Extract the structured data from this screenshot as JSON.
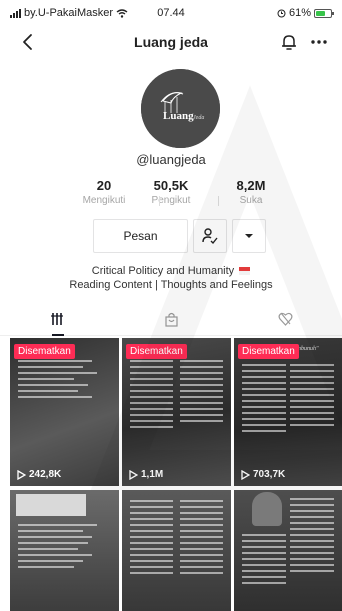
{
  "status_bar": {
    "carrier": "by.U-PakaiMasker",
    "time": "07.44",
    "battery": "61%",
    "battery_level": 0.61
  },
  "nav": {
    "title": "Luang jeda"
  },
  "profile": {
    "handle": "@luangjeda",
    "avatar_text": "Luang",
    "avatar_script": "Jeda",
    "stats": [
      {
        "value": "20",
        "label": "Mengikuti"
      },
      {
        "value": "50,5K",
        "label": "Pengikut"
      },
      {
        "value": "8,2M",
        "label": "Suka"
      }
    ],
    "message_button": "Pesan",
    "bio_line1": "Critical Politicy and Humanity",
    "bio_line2": "Reading Content | Thoughts and Feelings"
  },
  "tabs": [
    {
      "icon": "grid-icon"
    },
    {
      "icon": "shopping-bag-icon"
    },
    {
      "icon": "liked-heart-icon"
    }
  ],
  "videos": [
    {
      "pinned": "Disematkan",
      "views": "242,8K"
    },
    {
      "pinned": "Disematkan",
      "views": "1,1M"
    },
    {
      "pinned": "Disematkan",
      "views": "703,7K",
      "heading": "Ayah Bukan Pembunuh"
    },
    {
      "pinned": "",
      "views": ""
    },
    {
      "pinned": "",
      "views": ""
    },
    {
      "pinned": "",
      "views": ""
    }
  ],
  "colors": {
    "accent": "#fe2c55",
    "text": "#161823",
    "muted": "#a6a6a6"
  }
}
